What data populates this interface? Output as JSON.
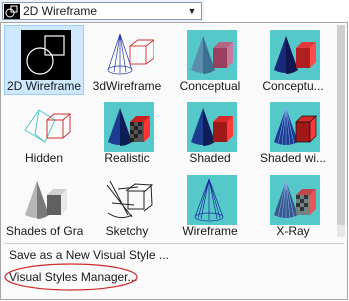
{
  "dropdown": {
    "selected_label": "2D Wireframe",
    "icon": "2d-wireframe-icon"
  },
  "styles": [
    {
      "label": "2D Wireframe",
      "icon": "2d-wireframe-thumbnail",
      "selected": true
    },
    {
      "label": "3dWireframe",
      "icon": "3d-wireframe-thumbnail",
      "selected": false
    },
    {
      "label": "Conceptual",
      "icon": "conceptual-thumbnail",
      "selected": false
    },
    {
      "label": "Conceptu...",
      "icon": "conceptual-variant-thumbnail",
      "selected": false
    },
    {
      "label": "Hidden",
      "icon": "hidden-thumbnail",
      "selected": false
    },
    {
      "label": "Realistic",
      "icon": "realistic-thumbnail",
      "selected": false
    },
    {
      "label": "Shaded",
      "icon": "shaded-thumbnail",
      "selected": false
    },
    {
      "label": "Shaded wi...",
      "icon": "shaded-with-edges-thumbnail",
      "selected": false
    },
    {
      "label": "Shades of Gray",
      "icon": "shades-of-gray-thumbnail",
      "selected": false
    },
    {
      "label": "Sketchy",
      "icon": "sketchy-thumbnail",
      "selected": false
    },
    {
      "label": "Wireframe",
      "icon": "wireframe-thumbnail",
      "selected": false
    },
    {
      "label": "X-Ray",
      "icon": "x-ray-thumbnail",
      "selected": false
    }
  ],
  "commands": {
    "save_as": "Save as a New Visual Style ...",
    "manager": "Visual Styles Manager..."
  },
  "colors": {
    "thumb_bg": "#55c9c9",
    "selection": "#cde8ff",
    "annotation_circle": "#cc2a2a"
  }
}
